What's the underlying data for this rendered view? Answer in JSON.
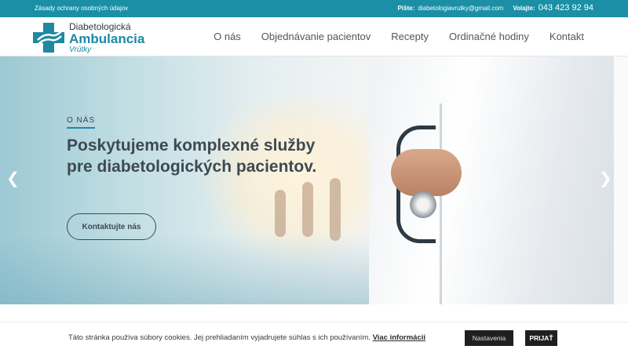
{
  "topbar": {
    "privacy_link": "Zásady ochrany osobných údajov",
    "write_label": "Píšte:",
    "email": "diabetologiavrutky@gmail.com",
    "call_label": "Volajte:",
    "phone": "043 423 92 94"
  },
  "logo": {
    "line1": "Diabetologická",
    "line2": "Ambulancia",
    "line3": "Vrútky",
    "icon": "medical-cross-icon"
  },
  "nav": {
    "items": [
      "O nás",
      "Objednávanie pacientov",
      "Recepty",
      "Ordinačné hodiny",
      "Kontakt"
    ]
  },
  "hero": {
    "eyebrow": "O NÁS",
    "headline": "Poskytujeme komplexné služby pre diabetologických pacientov.",
    "cta": "Kontaktujte nás",
    "prev_icon": "chevron-left-icon",
    "next_icon": "chevron-right-icon"
  },
  "cookie": {
    "message": "Táto stránka používa súbory cookies. Jej prehliadaním vyjadrujete súhlas s ich používaním.",
    "more_link": "Viac informácií",
    "settings_button": "Nastavenia",
    "accept_button": "PRIJAŤ"
  },
  "colors": {
    "accent": "#1a8fa6",
    "text_dark": "#3d4a52",
    "cookie_button": "#1f1f1f"
  }
}
